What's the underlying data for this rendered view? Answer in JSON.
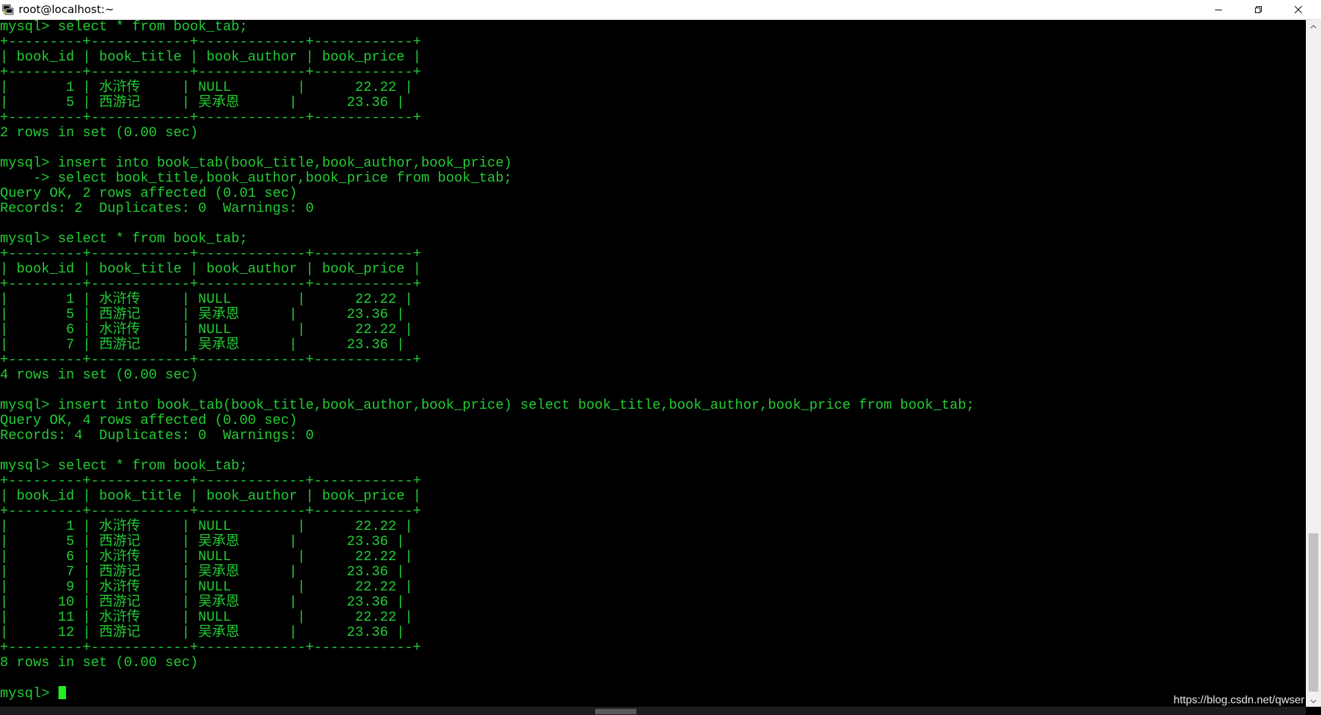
{
  "window": {
    "title": "root@localhost:~",
    "icon": "putty-terminal-icon",
    "controls": {
      "minimize": "minimize-icon",
      "maximize": "restore-icon",
      "close": "close-icon"
    }
  },
  "terminal": {
    "colors": {
      "background": "#000000",
      "text": "#22cc33",
      "cursor": "#22ee22"
    },
    "lines": [
      "mysql> select * from book_tab;",
      "+---------+------------+-------------+------------+",
      "| book_id | book_title | book_author | book_price |",
      "+---------+------------+-------------+------------+",
      "|       1 | 水浒传     | NULL        |      22.22 |",
      "|       5 | 西游记     | 吴承恩      |      23.36 |",
      "+---------+------------+-------------+------------+",
      "2 rows in set (0.00 sec)",
      "",
      "mysql> insert into book_tab(book_title,book_author,book_price)",
      "    -> select book_title,book_author,book_price from book_tab;",
      "Query OK, 2 rows affected (0.01 sec)",
      "Records: 2  Duplicates: 0  Warnings: 0",
      "",
      "mysql> select * from book_tab;",
      "+---------+------------+-------------+------------+",
      "| book_id | book_title | book_author | book_price |",
      "+---------+------------+-------------+------------+",
      "|       1 | 水浒传     | NULL        |      22.22 |",
      "|       5 | 西游记     | 吴承恩      |      23.36 |",
      "|       6 | 水浒传     | NULL        |      22.22 |",
      "|       7 | 西游记     | 吴承恩      |      23.36 |",
      "+---------+------------+-------------+------------+",
      "4 rows in set (0.00 sec)",
      "",
      "mysql> insert into book_tab(book_title,book_author,book_price) select book_title,book_author,book_price from book_tab;",
      "Query OK, 4 rows affected (0.00 sec)",
      "Records: 4  Duplicates: 0  Warnings: 0",
      "",
      "mysql> select * from book_tab;",
      "+---------+------------+-------------+------------+",
      "| book_id | book_title | book_author | book_price |",
      "+---------+------------+-------------+------------+",
      "|       1 | 水浒传     | NULL        |      22.22 |",
      "|       5 | 西游记     | 吴承恩      |      23.36 |",
      "|       6 | 水浒传     | NULL        |      22.22 |",
      "|       7 | 西游记     | 吴承恩      |      23.36 |",
      "|       9 | 水浒传     | NULL        |      22.22 |",
      "|      10 | 西游记     | 吴承恩      |      23.36 |",
      "|      11 | 水浒传     | NULL        |      22.22 |",
      "|      12 | 西游记     | 吴承恩      |      23.36 |",
      "+---------+------------+-------------+------------+",
      "8 rows in set (0.00 sec)",
      ""
    ],
    "prompt": "mysql> "
  },
  "overlay": {
    "watermark": "https://blog.csdn.net/qwser"
  },
  "scrollbar": {
    "position_fraction": 1.0
  }
}
